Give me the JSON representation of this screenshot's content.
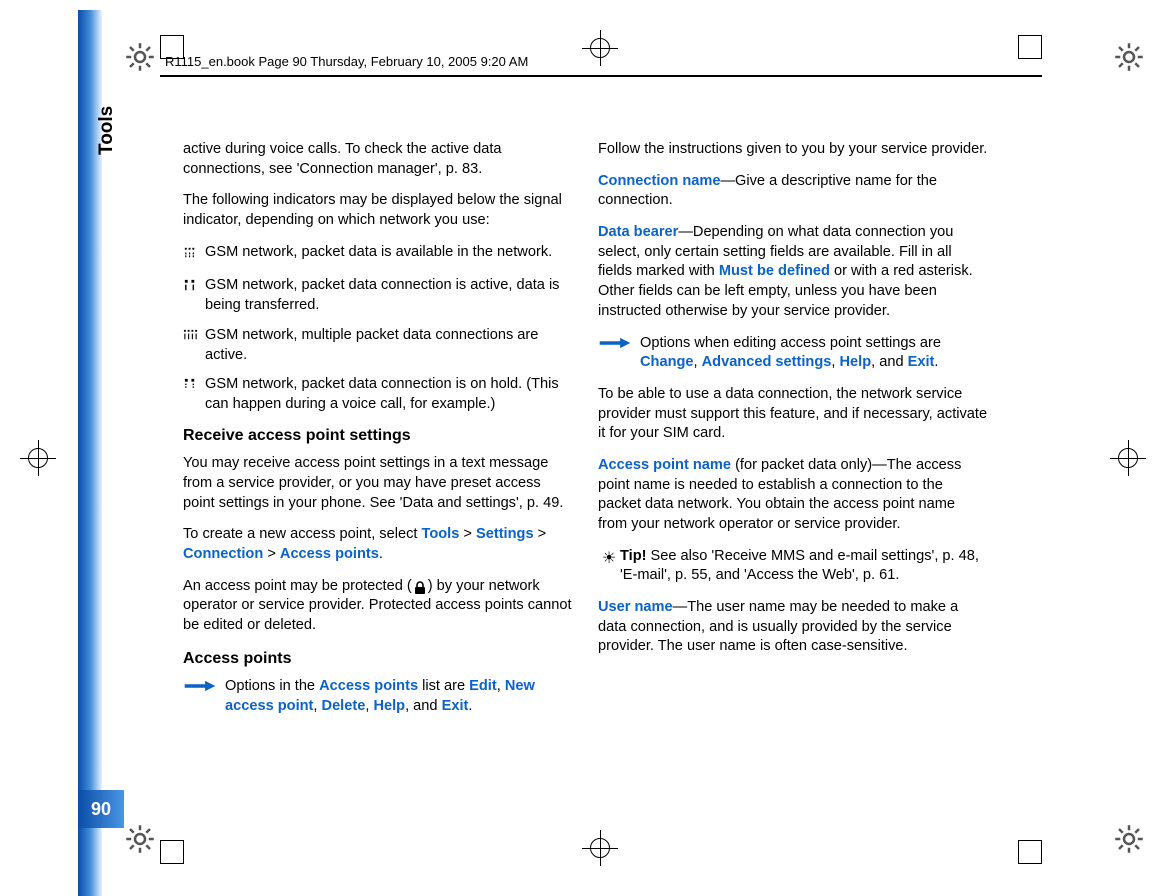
{
  "meta": {
    "header": "R1115_en.book  Page 90  Thursday, February 10, 2005  9:20 AM",
    "side_label": "Tools",
    "page_number": "90"
  },
  "col1": {
    "p1": "active during voice calls. To check the active data connections, see 'Connection manager', p. 83.",
    "p2": "The following indicators may be displayed below the signal indicator, depending on which network you use:",
    "ind1": " GSM network, packet data is available in the network.",
    "ind2": " GSM network, packet data connection is active, data is being transferred.",
    "ind3": " GSM network, multiple packet data connections are active.",
    "ind4": " GSM network, packet data connection is on hold. (This can happen during a voice call, for example.)",
    "h_recv": "Receive access point settings",
    "p3": "You may receive access point settings in a text message from a service provider, or you may have preset access point settings in your phone. See 'Data and settings', p. 49.",
    "p4a": "To create a new access point, select ",
    "p4_tools": "Tools",
    "p4_settings": "Settings",
    "p4_connection": "Connection",
    "p4_ap": "Access points",
    "p4_gt": " > ",
    "p4_dot": ".",
    "p5a": "An access point may be protected (",
    "p5b": ") by your network operator or service provider. Protected access points cannot be edited or deleted.",
    "h_ap": "Access points",
    "opt1a": " Options in the ",
    "opt1_ap": "Access points",
    "opt1b": " list are ",
    "opt1_edit": "Edit",
    "opt1_new": "New access point",
    "opt1_delete": "Delete",
    "opt1_help": "Help",
    "opt1_exit": "Exit",
    "opt1_comma": ", ",
    "opt1_and": ", and ",
    "opt1_dot": "."
  },
  "col2": {
    "p1": "Follow the instructions given to you by your service provider.",
    "cn_label": "Connection name",
    "cn_text": "—Give a descriptive name for the connection.",
    "db_label": "Data bearer",
    "db_a": "—Depending on what data connection you select, only certain setting fields are available. Fill in all fields marked with ",
    "db_must": "Must be defined",
    "db_b": " or with a red asterisk. Other fields can be left empty, unless you have been instructed otherwise by your service provider.",
    "opt2a": " Options when editing access point settings are ",
    "opt2_change": "Change",
    "opt2_adv": "Advanced settings",
    "opt2_help": "Help",
    "opt2_exit": "Exit",
    "opt2_comma": ", ",
    "opt2_and": ", and ",
    "opt2_dot": ".",
    "p2": "To be able to use a data connection, the network service provider must support this feature, and if necessary, activate it for your SIM card.",
    "apn_label": "Access point name",
    "apn_text": " (for packet data only)—The access point name is needed to establish a connection to the packet data network. You obtain the access point name from your network operator or service provider.",
    "tip_label": "Tip!",
    "tip_text": " See also 'Receive MMS and e-mail settings', p. 48, 'E-mail', p. 55, and 'Access the Web', p. 61.",
    "un_label": "User name",
    "un_text": "—The user name may be needed to make a data connection, and is usually provided by the service provider. The user name is often case-sensitive."
  }
}
